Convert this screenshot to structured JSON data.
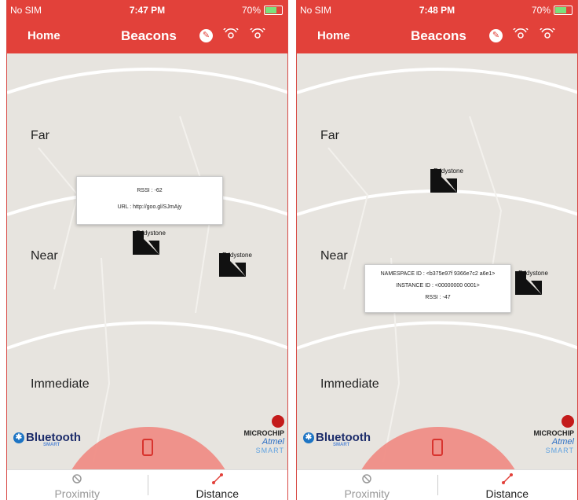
{
  "screens": [
    {
      "status": {
        "carrier": "No SIM",
        "time": "7:47 PM",
        "battery": "70%"
      },
      "nav": {
        "home": "Home",
        "title": "Beacons"
      },
      "zones": {
        "far": "Far",
        "near": "Near",
        "immediate": "Immediate"
      },
      "beacons": [
        "Eddystone",
        "Eddystone"
      ],
      "popup": {
        "line1": "RSSI : -62",
        "line2": "URL : http://goo.gl/SJmAjy"
      },
      "brand": {
        "bluetooth": "Bluetooth",
        "smart": "SMART",
        "mc1": "MICROCHIP",
        "mc2": "Atmel",
        "mc3": "SMART"
      },
      "tabs": {
        "proximity": "Proximity",
        "distance": "Distance"
      }
    },
    {
      "status": {
        "carrier": "No SIM",
        "time": "7:48 PM",
        "battery": "70%"
      },
      "nav": {
        "home": "Home",
        "title": "Beacons"
      },
      "zones": {
        "far": "Far",
        "near": "Near",
        "immediate": "Immediate"
      },
      "beacons": [
        "Eddystone",
        "Eddystone"
      ],
      "popup": {
        "line1": "NAMESPACE ID : <b375e97f 9366e7c2 a6e1>",
        "line2": "INSTANCE ID : <00000000 0001>",
        "line3": "RSSI : -47"
      },
      "brand": {
        "bluetooth": "Bluetooth",
        "smart": "SMART",
        "mc1": "MICROCHIP",
        "mc2": "Atmel",
        "mc3": "SMART"
      },
      "tabs": {
        "proximity": "Proximity",
        "distance": "Distance"
      }
    }
  ],
  "colors": {
    "accent": "#e2413a",
    "map": "#e7e4df",
    "zone_fill": "#ef8d86"
  }
}
